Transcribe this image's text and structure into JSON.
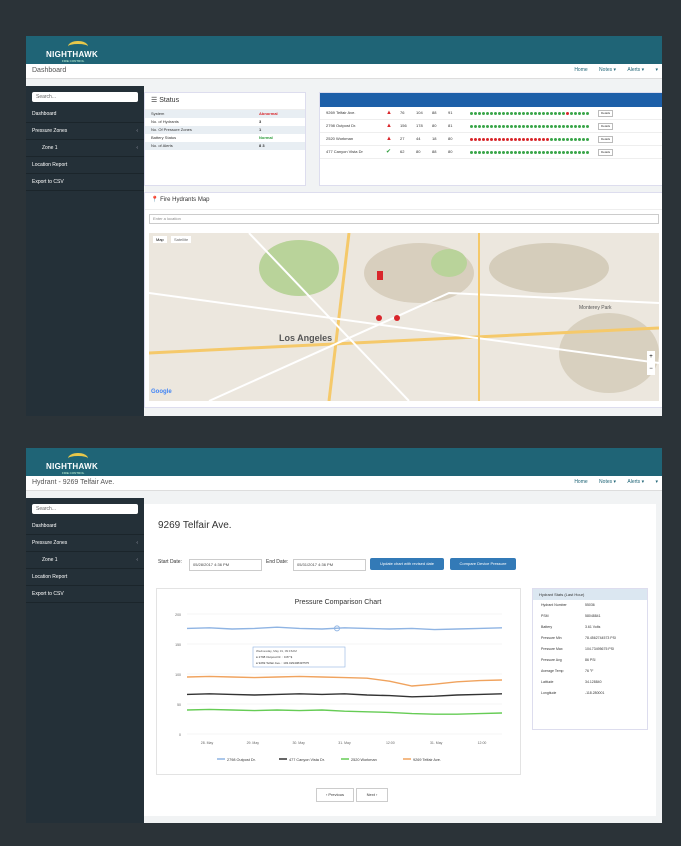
{
  "brand": {
    "name": "NIGHTHAWK",
    "tagline": "FIRE CONTROL"
  },
  "nav": {
    "home": "Home",
    "notes": "Notes ▾",
    "alerts": "Alerts ▾",
    "user": "▾"
  },
  "sidebar": {
    "search_placeholder": "Search...",
    "items": [
      "Dashboard",
      "Pressure Zones",
      "Zone 1",
      "Location Report",
      "Export to CSV"
    ]
  },
  "dashboard": {
    "breadcrumb": "Dashboard",
    "status": {
      "title": "Status",
      "rows": [
        {
          "label": "System",
          "value": "Abnormal",
          "color": "#d9262b"
        },
        {
          "label": "No. of Hydrants",
          "value": "3",
          "color": "#333333"
        },
        {
          "label": "No. Of Pressure Zones",
          "value": "1",
          "color": "#333333"
        },
        {
          "label": "Battery Status",
          "value": "Normal",
          "color": "#2e9c3c"
        },
        {
          "label": "No. of Alerts",
          "value": "8 3",
          "color": "#333333"
        }
      ]
    },
    "hydrants": [
      {
        "address": "9269 Telfair Ave.",
        "icon": "▲",
        "icon_color": "#d9262b",
        "a": "76",
        "b": "104",
        "c": "88",
        "d": "91",
        "reds": [
          24
        ]
      },
      {
        "address": "2798 Outpost Dr.",
        "icon": "▲",
        "icon_color": "#d9262b",
        "a": "156",
        "b": "178",
        "c": "80",
        "d": "81",
        "reds": []
      },
      {
        "address": "2520 Workman",
        "icon": "▲",
        "icon_color": "#d9262b",
        "a": "27",
        "b": "44",
        "c": "18",
        "d": "80",
        "reds": [
          0,
          1,
          2,
          3,
          4,
          5,
          6,
          7,
          8,
          9,
          10,
          11,
          12,
          13,
          14,
          15,
          16,
          17,
          18,
          19
        ]
      },
      {
        "address": "477 Canyon Vista Dr",
        "icon": "✔",
        "icon_color": "#2e9c3c",
        "a": "62",
        "b": "80",
        "c": "88",
        "d": "80",
        "reds": []
      }
    ],
    "details_label": "Details",
    "map": {
      "title": "Fire Hydrants Map",
      "search_placeholder": "Enter a location",
      "tab_map": "Map",
      "tab_satellite": "Satellite",
      "city": "Los Angeles",
      "park": "Monterey Park",
      "google": "Google"
    }
  },
  "detail": {
    "breadcrumb": "Hydrant - 9269 Telfair Ave.",
    "title": "9269 Telfair Ave.",
    "start_label": "Start Date:",
    "start_value": "05/28/2017 4:36 PM",
    "end_label": "End Date:",
    "end_value": "05/31/2017 4:36 PM",
    "update_button": "Update chart with revised date",
    "compare_button": "Compare Device Pressure",
    "chart_title": "Pressure Comparison Chart",
    "stats_title": "Hydrant Stats (Last Hour)",
    "stats": [
      {
        "label": "Hydrant Number",
        "value": "55036"
      },
      {
        "label": "PSM",
        "value": "58048841"
      },
      {
        "label": "Battery",
        "value": "3.61 Volts"
      },
      {
        "label": "Pressure Min",
        "value": "78.4562744573 PSI"
      },
      {
        "label": "Pressure Max",
        "value": "104.73495675 PSI"
      },
      {
        "label": "Pressure Avg",
        "value": "86 PSI"
      },
      {
        "label": "Average Temp",
        "value": "76 °F"
      },
      {
        "label": "Latitude",
        "value": "34.128840"
      },
      {
        "label": "Longitude",
        "value": "-118.280001"
      }
    ],
    "tooltip": {
      "date": "Wednesday, May 31, 09:15AM",
      "l1": "● 2798 Outpost Dr. : 0.87 $",
      "l2": "● 9269 Telfair Ave. : 103.029408497575"
    },
    "prev": "‹ Previous",
    "next": "Next ›"
  },
  "chart_data": {
    "type": "line",
    "title": "Pressure Comparison Chart",
    "x_ticks": [
      "28. May",
      "29. May",
      "30. May",
      "31. May",
      "12:00",
      "31. May",
      "12:00"
    ],
    "y_ticks": [
      "200",
      "150",
      "100",
      "50",
      "0"
    ],
    "ylim": [
      0,
      200
    ],
    "series": [
      {
        "name": "2798 Outpost Dr.",
        "color": "#8fb4e3",
        "values": [
          176,
          177,
          175,
          176,
          178,
          176,
          175,
          177,
          176,
          175,
          176,
          174,
          175,
          176,
          177
        ]
      },
      {
        "name": "477 Canyon Vista Dr.",
        "color": "#333333",
        "values": [
          66,
          67,
          66,
          65,
          66,
          67,
          66,
          67,
          65,
          64,
          62,
          63,
          65,
          66,
          67
        ]
      },
      {
        "name": "2520 Workman",
        "color": "#66cc55",
        "values": [
          40,
          41,
          40,
          39,
          40,
          39,
          40,
          38,
          37,
          36,
          34,
          33,
          33,
          34,
          35
        ]
      },
      {
        "name": "9269 Telfair Ave.",
        "color": "#f0a35e",
        "values": [
          95,
          96,
          95,
          94,
          95,
          96,
          95,
          94,
          93,
          88,
          80,
          83,
          87,
          89,
          90
        ]
      }
    ],
    "legend_position": "bottom"
  }
}
